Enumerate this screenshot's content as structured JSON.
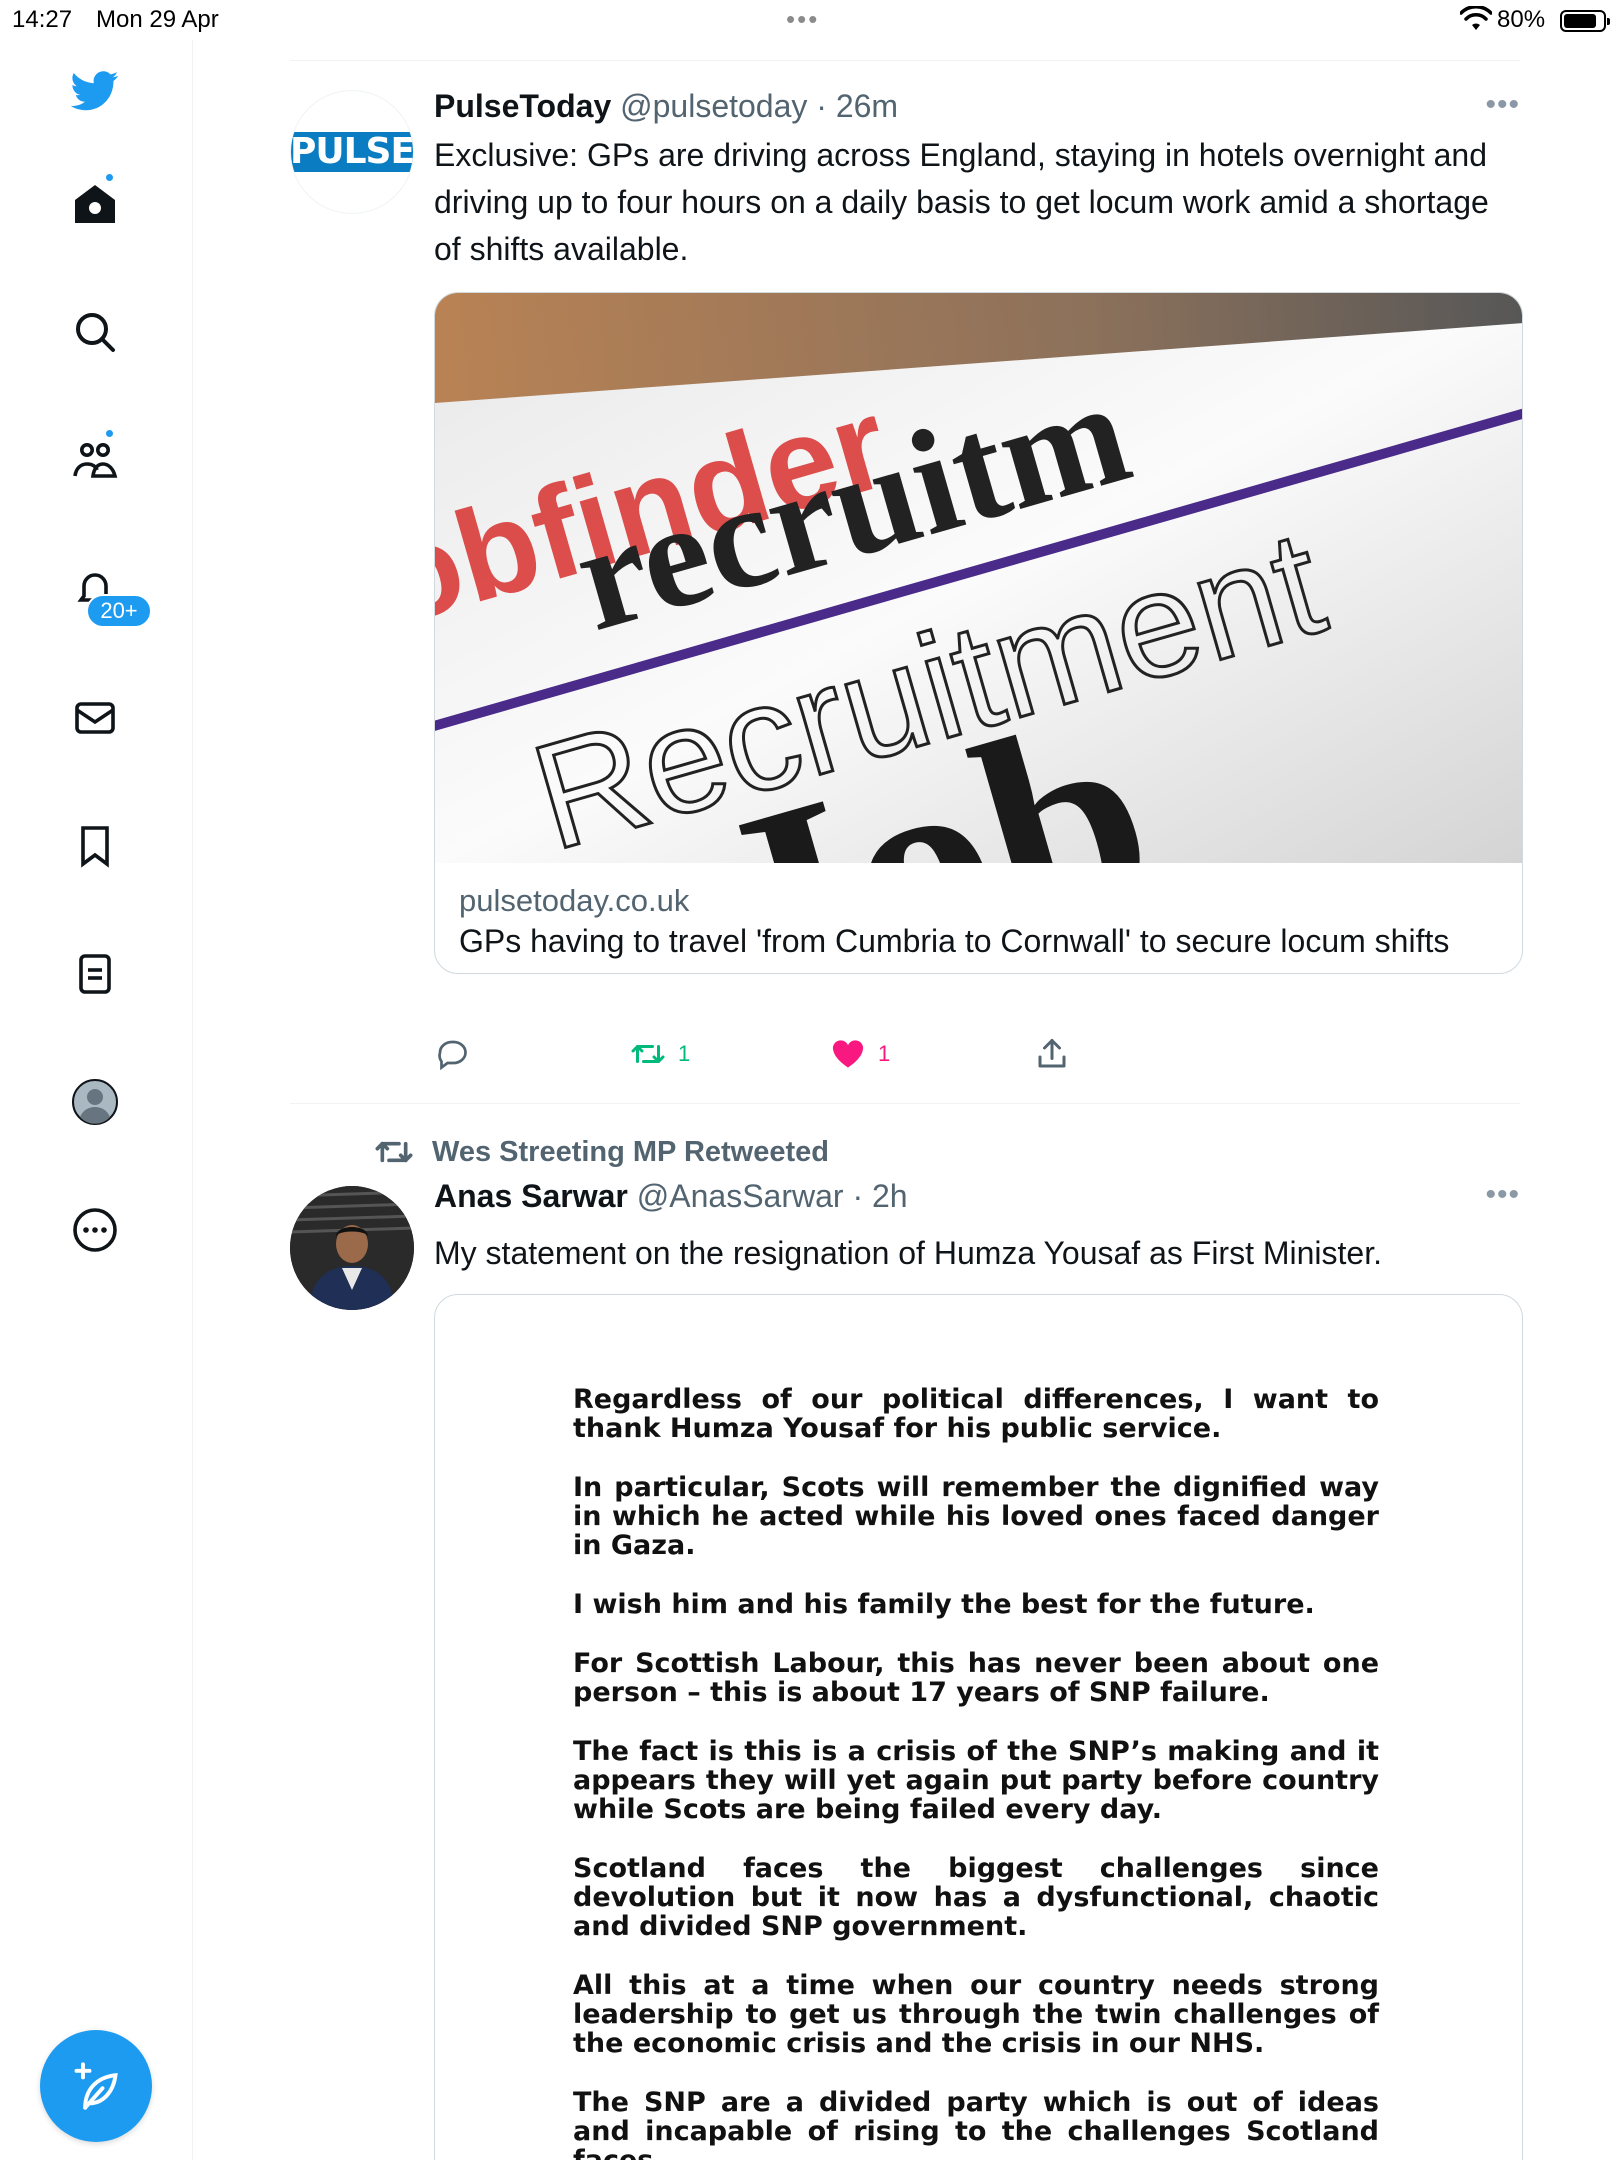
{
  "status_bar": {
    "time": "14:27",
    "date": "Mon 29 Apr",
    "center_dots": "•••",
    "battery": "80%"
  },
  "sidebar": {
    "items": [
      {
        "name": "twitter-logo-icon"
      },
      {
        "name": "home-icon",
        "dot": true
      },
      {
        "name": "search-icon"
      },
      {
        "name": "communities-icon",
        "dot": true
      },
      {
        "name": "notifications-icon",
        "badge": "20+"
      },
      {
        "name": "messages-icon"
      },
      {
        "name": "bookmarks-icon"
      },
      {
        "name": "lists-icon"
      },
      {
        "name": "profile-icon"
      },
      {
        "name": "more-icon"
      }
    ],
    "notification_badge": "20+",
    "compose_icon": "compose-feather-icon"
  },
  "tweets": [
    {
      "avatar_text": "PULSE",
      "name": "PulseToday",
      "handle": "@pulsetoday",
      "separator": "·",
      "time": "26m",
      "more": "•••",
      "text": "Exclusive: GPs are driving across England, staying in hotels overnight and driving up to four hours on a daily basis to get locum work amid a shortage of shifts available.",
      "card": {
        "domain": "pulsetoday.co.uk",
        "title": "GPs having to travel 'from Cumbria to Cornwall' to secure locum shifts",
        "image_words": [
          "obfinder",
          "recruitm",
          "Recruitment",
          "Job"
        ]
      },
      "actions": {
        "reply_count": "",
        "retweet_count": "1",
        "like_count": "1"
      },
      "colors": {
        "retweet": "#00ba7c",
        "like": "#f91880"
      }
    },
    {
      "retweeted_by": "Wes Streeting MP Retweeted",
      "name": "Anas Sarwar",
      "handle": "@AnasSarwar",
      "separator": "·",
      "time": "2h",
      "more": "•••",
      "text": "My statement on the resignation of Humza Yousaf as First Minister.",
      "statement": [
        "Regardless of our political differences, I want to thank Humza Yousaf for his public service.",
        "In particular, Scots will remember the dignified way in which he acted while his loved ones faced danger in Gaza.",
        "I wish him and his family the best for the future.",
        "For Scottish Labour, this has never been about one person – this is about 17 years of SNP failure.",
        "The fact is this is a crisis of the SNP’s making and it appears they will yet again put party before country while Scots are being failed every day.",
        "Scotland faces the biggest challenges since devolution but it now has a dysfunctional, chaotic and divided SNP government.",
        "All this at a time when our country needs strong leadership to get us through the twin challenges of the economic crisis and the crisis in our NHS.",
        "The SNP are a divided party which is out of ideas and incapable of rising to the challenges Scotland faces."
      ]
    }
  ],
  "accent": "#1d9bf0"
}
